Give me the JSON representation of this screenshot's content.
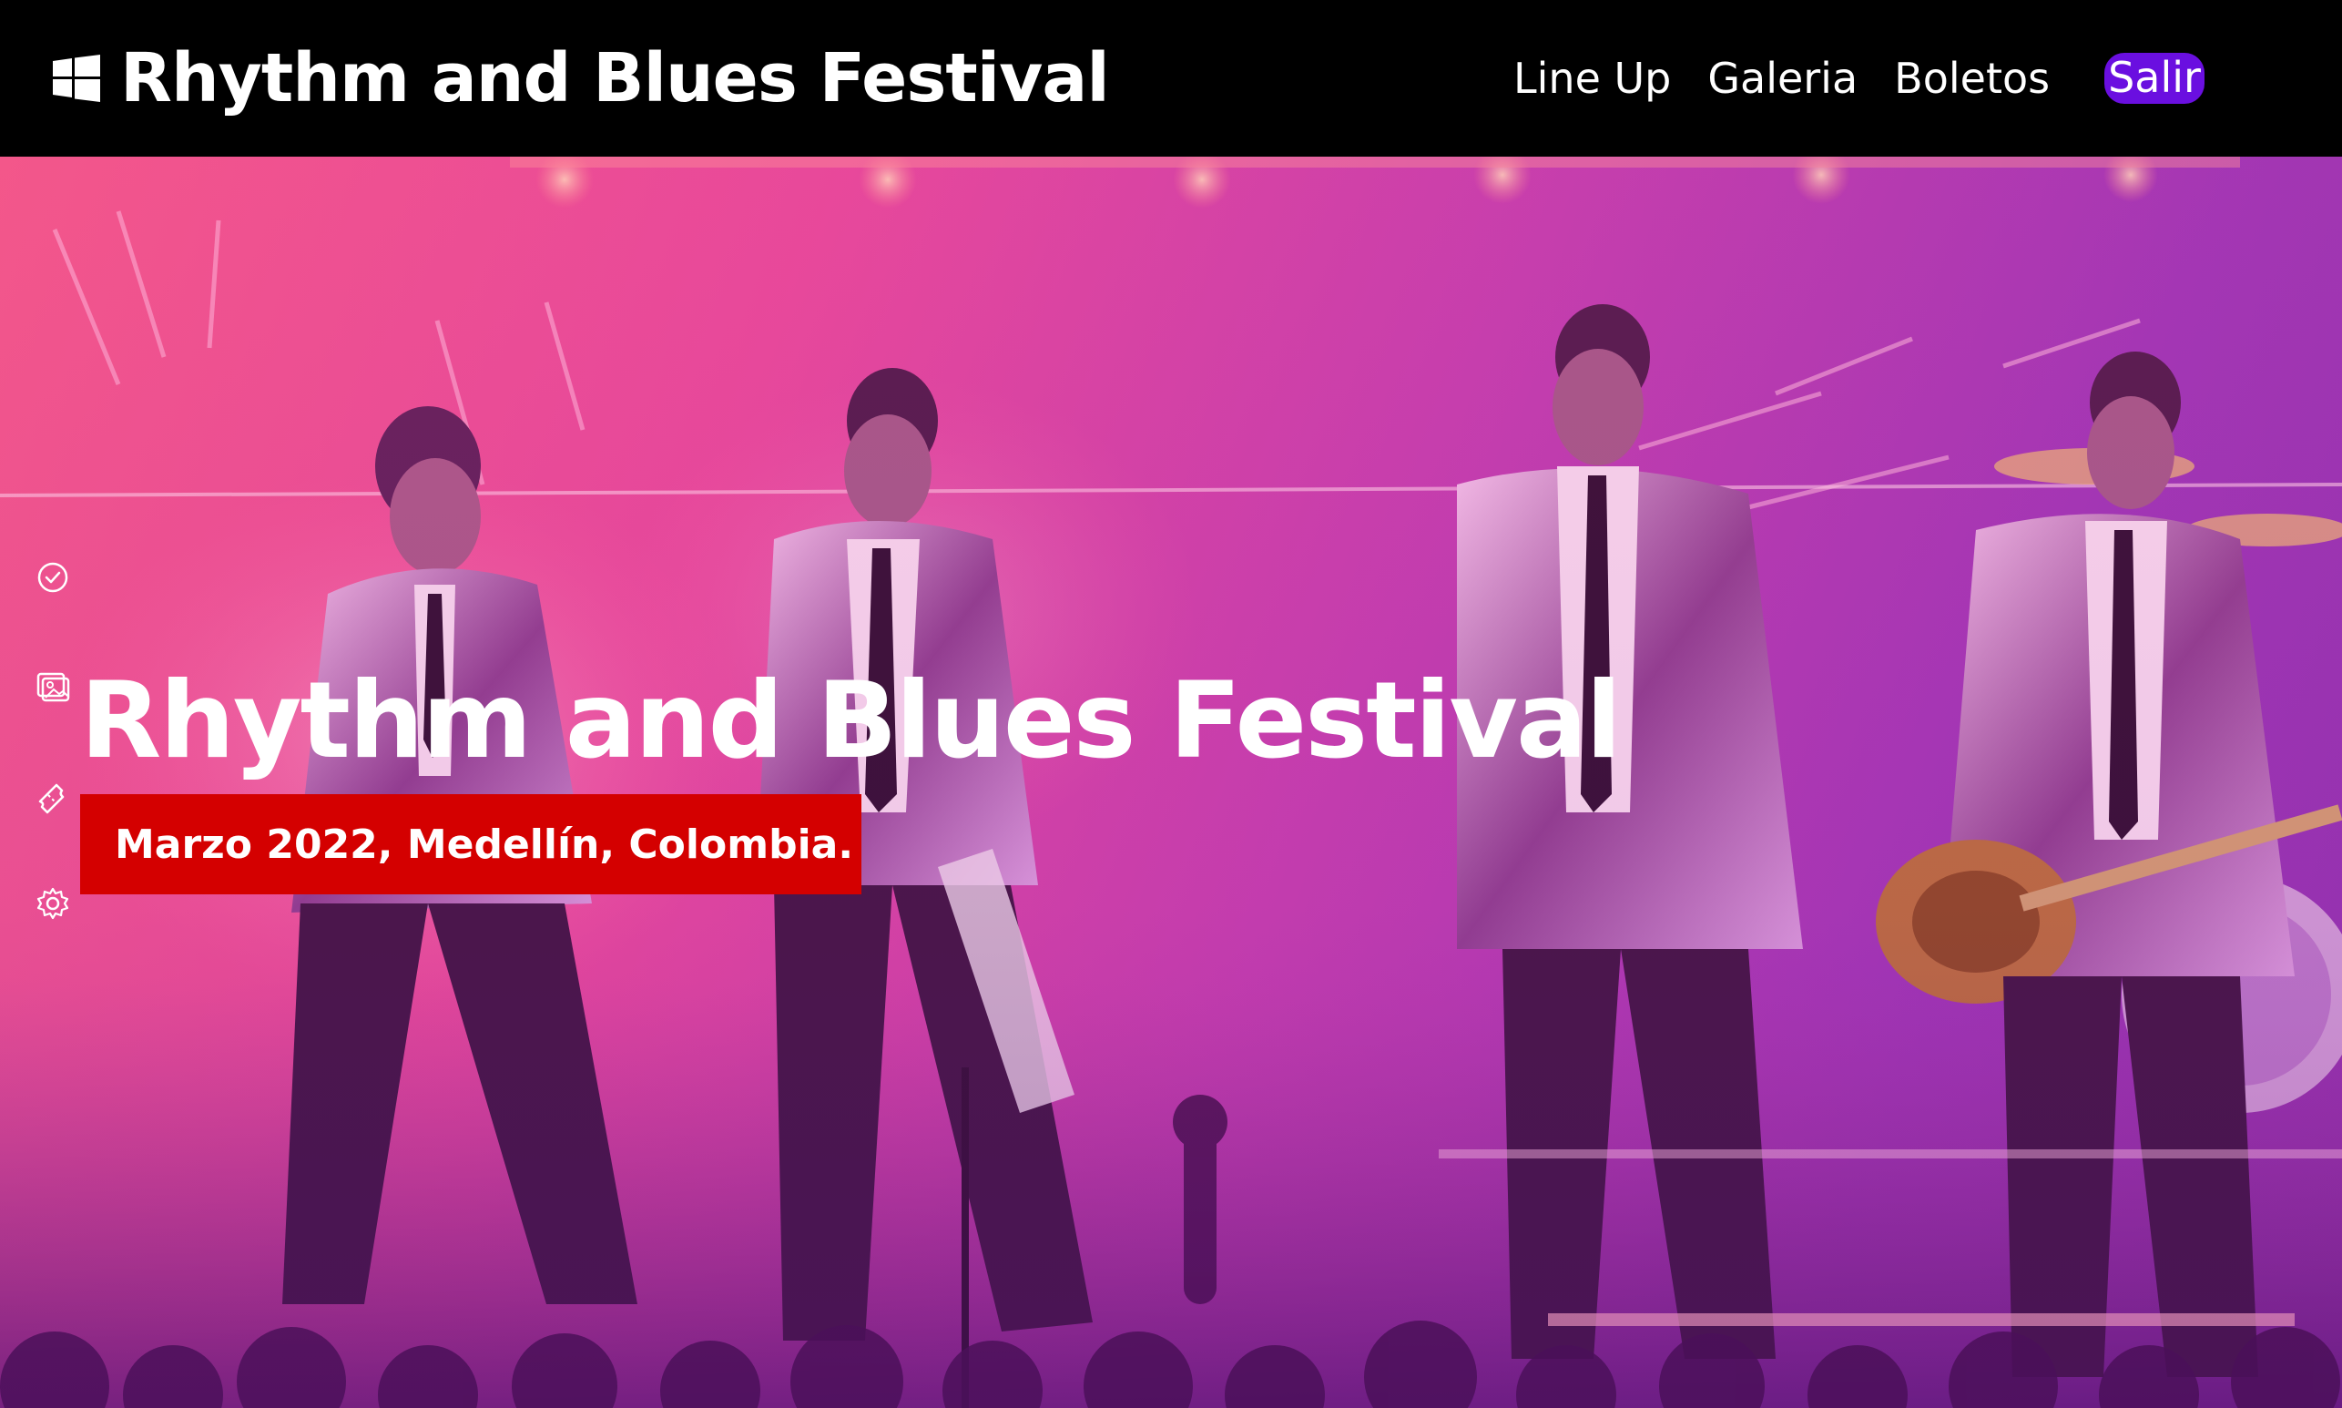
{
  "header": {
    "brand_icon": "windows-logo-icon",
    "brand_title": "Rhythm and Blues Festival",
    "nav": [
      {
        "label": "Line Up"
      },
      {
        "label": "Galeria"
      },
      {
        "label": "Boletos"
      }
    ],
    "exit_label": "Salir",
    "exit_color": "#6a0fe0"
  },
  "sidebar": {
    "icons": [
      {
        "name": "check-circle-icon"
      },
      {
        "name": "image-gallery-icon"
      },
      {
        "name": "ticket-icon"
      },
      {
        "name": "gear-icon"
      }
    ]
  },
  "hero": {
    "title": "Rhythm and Blues Festival",
    "subtitle": "Marzo 2022, Medellín, Colombia.",
    "badge_color": "#d40000",
    "overlay_color": "#e64a9c"
  }
}
